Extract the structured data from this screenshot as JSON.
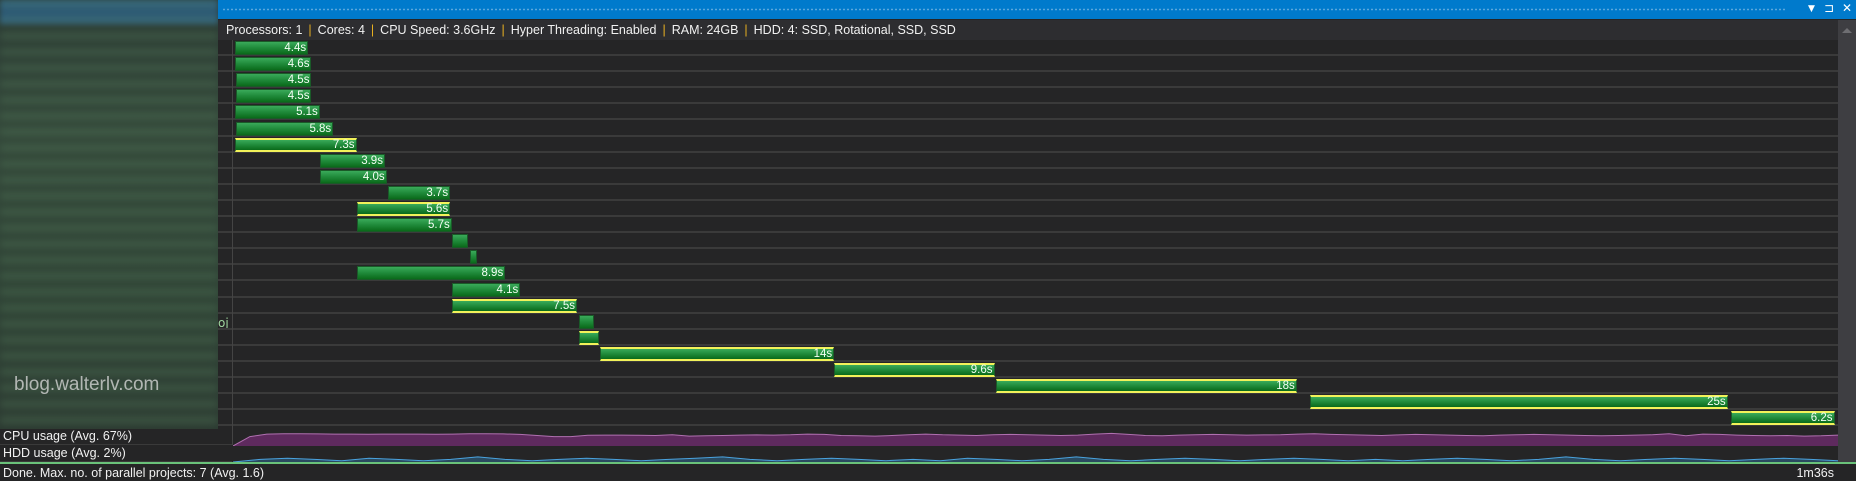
{
  "window": {
    "menu_icon": "dropdown-arrow-icon",
    "pin_icon": "pin-icon",
    "close_icon": "close-icon",
    "colors": {
      "titlebar": "#007acc",
      "bar": "#1f8a3a",
      "critical": "#f2f25a",
      "cpu": "#5e2a5e",
      "hdd": "#4aa3df"
    }
  },
  "header": {
    "items": [
      "Processors: 1",
      "Cores: 4",
      "CPU Speed: 3.6GHz",
      "Hyper Threading: Enabled",
      "RAM: 24GB",
      "HDD: 4: SSD, Rotational, SSD, SSD"
    ]
  },
  "sidebar": {
    "watermark": "blog.walterlv.com",
    "fragment": "oj"
  },
  "timeline": {
    "unit": "s",
    "total_seconds": 96,
    "rows": [
      {
        "start": 0.1,
        "duration": 4.4,
        "label": "4.4s",
        "critical": false
      },
      {
        "start": 0.1,
        "duration": 4.6,
        "label": "4.6s",
        "critical": false
      },
      {
        "start": 0.2,
        "duration": 4.5,
        "label": "4.5s",
        "critical": false
      },
      {
        "start": 0.2,
        "duration": 4.5,
        "label": "4.5s",
        "critical": false
      },
      {
        "start": 0.1,
        "duration": 5.1,
        "label": "5.1s",
        "critical": false
      },
      {
        "start": 0.2,
        "duration": 5.8,
        "label": "5.8s",
        "critical": false
      },
      {
        "start": 0.1,
        "duration": 7.3,
        "label": "7.3s",
        "critical": true
      },
      {
        "start": 5.2,
        "duration": 3.9,
        "label": "3.9s",
        "critical": false
      },
      {
        "start": 5.2,
        "duration": 4.0,
        "label": "4.0s",
        "critical": false
      },
      {
        "start": 9.3,
        "duration": 3.7,
        "label": "3.7s",
        "critical": false
      },
      {
        "start": 7.4,
        "duration": 5.6,
        "label": "5.6s",
        "critical": true
      },
      {
        "start": 7.4,
        "duration": 5.7,
        "label": "5.7s",
        "critical": false
      },
      {
        "start": 13.1,
        "duration": 1.0,
        "label": "",
        "critical": false
      },
      {
        "start": 14.2,
        "duration": 0.4,
        "label": "",
        "critical": false
      },
      {
        "start": 7.4,
        "duration": 8.9,
        "label": "8.9s",
        "critical": false
      },
      {
        "start": 13.1,
        "duration": 4.1,
        "label": "4.1s",
        "critical": false
      },
      {
        "start": 13.1,
        "duration": 7.5,
        "label": "7.5s",
        "critical": true
      },
      {
        "start": 20.7,
        "duration": 0.9,
        "label": "",
        "critical": false
      },
      {
        "start": 20.7,
        "duration": 1.2,
        "label": "",
        "critical": true
      },
      {
        "start": 22.0,
        "duration": 14,
        "label": "14s",
        "critical": true
      },
      {
        "start": 36.0,
        "duration": 9.6,
        "label": "9.6s",
        "critical": true
      },
      {
        "start": 45.7,
        "duration": 18,
        "label": "18s",
        "critical": true
      },
      {
        "start": 64.5,
        "duration": 25,
        "label": "25s",
        "critical": true
      },
      {
        "start": 89.7,
        "duration": 6.2,
        "label": "6.2s",
        "critical": true
      }
    ]
  },
  "usage": {
    "cpu_label": "CPU usage (Avg. 67%)",
    "hdd_label": "HDD usage (Avg. 2%)",
    "cpu_percent": [
      0,
      55,
      70,
      72,
      72,
      71,
      70,
      70,
      69,
      70,
      70,
      70,
      69,
      70,
      72,
      72,
      71,
      68,
      62,
      55,
      55,
      63,
      64,
      64,
      63,
      62,
      66,
      58,
      60,
      62,
      64,
      65,
      64,
      66,
      70,
      68,
      62,
      60,
      58,
      62,
      66,
      70,
      66,
      64,
      62,
      66,
      68,
      66,
      64,
      62,
      64,
      70,
      74,
      68,
      62,
      60,
      64,
      66,
      68,
      66,
      64,
      65,
      66,
      70,
      72,
      68,
      66,
      64,
      62,
      65,
      68,
      66,
      64,
      62,
      60,
      64,
      66,
      68,
      66,
      64,
      62,
      60,
      62,
      64,
      66,
      72,
      60,
      70,
      68,
      64,
      62,
      60,
      62,
      58,
      60,
      64
    ],
    "hdd_percent": [
      0,
      2,
      3,
      2,
      1,
      3,
      2,
      1,
      2,
      4,
      2,
      1,
      2,
      3,
      2,
      1,
      2,
      3,
      4,
      2,
      1,
      2,
      3,
      2,
      1,
      2,
      1,
      3,
      2,
      1,
      2,
      4,
      2,
      1,
      2,
      3,
      2,
      1,
      2,
      3,
      2,
      1,
      2,
      1,
      2,
      3,
      2,
      1,
      2,
      4,
      2,
      1,
      2,
      3,
      2,
      1,
      2,
      3,
      2,
      1
    ]
  },
  "status": {
    "text": "Done. Max. no. of parallel projects: 7 (Avg. 1.6)",
    "elapsed": "1m36s"
  }
}
